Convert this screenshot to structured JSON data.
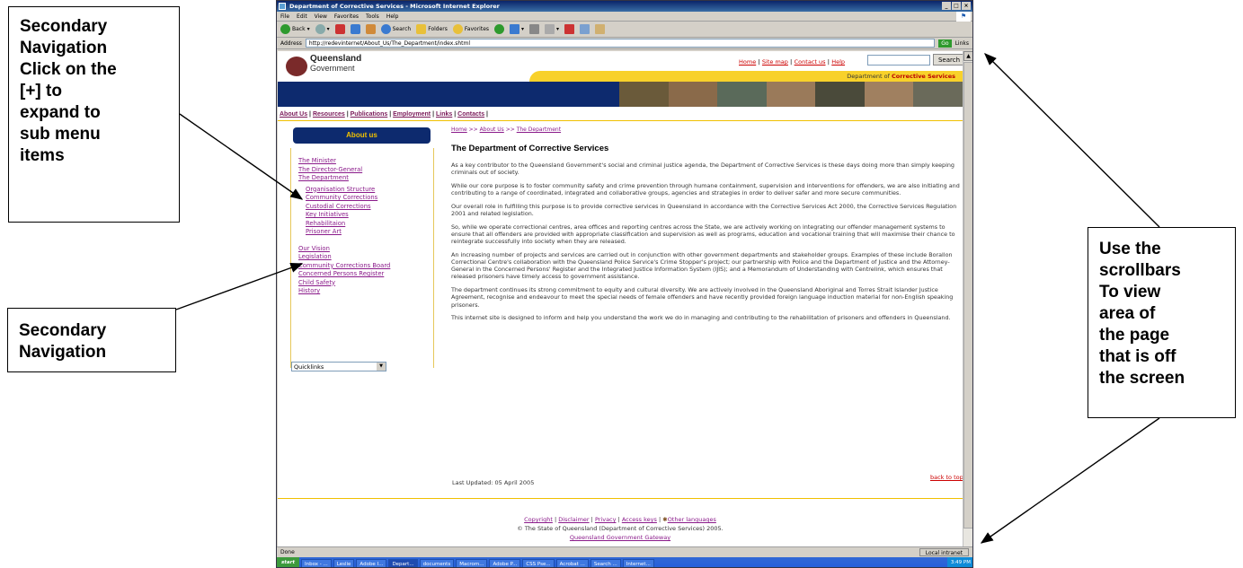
{
  "callouts": {
    "secondary_nav_expand": [
      "Secondary",
      "Navigation",
      "Click on the",
      "[+] to",
      "expand to",
      "sub menu",
      "items"
    ],
    "secondary_nav": [
      "Secondary",
      "Navigation"
    ],
    "scrollbars": [
      "Use the",
      "scrollbars",
      "To view",
      "area of",
      "the page",
      "that is off",
      "the screen"
    ]
  },
  "browser": {
    "title": "Department of Corrective Services - Microsoft Internet Explorer",
    "menu": [
      "File",
      "Edit",
      "View",
      "Favorites",
      "Tools",
      "Help"
    ],
    "toolbar": {
      "back": "Back",
      "search": "Search",
      "folders": "Folders",
      "favorites": "Favorites"
    },
    "address_label": "Address",
    "address": "http://redevinternet/About_Us/The_Department/index.shtml",
    "go": "Go",
    "links": "Links",
    "status": "Done",
    "zone": "Local intranet"
  },
  "taskbar": {
    "start": "start",
    "tasks": [
      "Inbox - ...",
      "Leslie",
      "Adobe I...",
      "Depart...",
      "documents",
      "Macrom...",
      "Adobe P...",
      "CSS Pse...",
      "Acrobat ...",
      "Search ...",
      "Internet..."
    ],
    "active_index": 3,
    "clock": "3:49 PM"
  },
  "site": {
    "logo_line1": "Queensland",
    "logo_line2": "Government",
    "top_links": [
      "Home",
      "Site map",
      "Contact us",
      "Help"
    ],
    "search_button": "Search",
    "dept_prefix": "Department of ",
    "dept_bold": "Corrective Services",
    "main_nav": [
      "About Us",
      "Resources",
      "Publications",
      "Employment",
      "Links",
      "Contacts"
    ],
    "left_heading": "About us",
    "left_nav": {
      "group1": [
        "The Minister",
        "The Director-General",
        "The Department"
      ],
      "sub": [
        "Organisation Structure",
        "Community Corrections",
        "Custodial Corrections",
        "Key Initiatives",
        "Rehabilitaion",
        "Prisoner Art"
      ],
      "group2": [
        "Our Vision",
        "Legislation",
        "Community Corrections Board",
        "Concerned Persons Register",
        "Child Safety",
        "History"
      ]
    },
    "quicklinks": "Quicklinks",
    "breadcrumb": [
      "Home",
      "About Us",
      "The Department"
    ],
    "breadcrumb_sep": ">>",
    "page_title": "The Department of Corrective Services",
    "paragraphs": [
      "As a key contributor to the Queensland Government's social and criminal justice agenda, the Department of Corrective Services is these days doing more than simply keeping criminals out of society.",
      "While our core purpose is to foster community safety and crime prevention through humane containment, supervision and interventions for offenders, we are also initiating and contributing to a range of coordinated, integrated and collaborative groups, agencies and strategies in order to deliver safer and more secure communities.",
      "Our overall role in fulfilling this purpose is to provide corrective services in Queensland in accordance with the Corrective Services Act 2000, the Corrective Services Regulation 2001 and related legislation.",
      "So, while we operate correctional centres, area offices and reporting centres across the State, we are actively working on integrating our offender management systems to ensure that all offenders are provided with appropriate classification and supervision as well as programs, education and vocational training that will maximise their chance to reintegrate successfully into society when they are released.",
      "An increasing number of projects and services are carried out in conjunction with other government departments and stakeholder groups. Examples of these include Borallon Correctional Centre's collaboration with the Queensland Police Service's Crime Stopper's project; our partnership with Police and the Department of Justice and the Attorney-General in the Concerned Persons' Register and the Integrated Justice Information System (IJIS); and a Memorandum of Understanding with Centrelink, which ensures that released prisoners have timely access to government assistance.",
      "The department continues its strong commitment to equity and cultural diversity. We are actively involved in the Queensland Aboriginal and Torres Strait Islander Justice Agreement, recognise and endeavour to meet the special needs of female offenders and have recently provided foreign language induction material for non-English speaking prisoners.",
      "This internet site is designed to inform and help you understand the work we do in managing and contributing to the rehabilitation of prisoners and offenders in Queensland."
    ],
    "back_to_top": "back to top ^",
    "last_updated": "Last Updated: 05 April 2005",
    "footer_links": [
      "Copyright",
      "Disclaimer",
      "Privacy",
      "Access keys",
      "Other languages"
    ],
    "footer_copyright": "© The State of Queensland (Department of Corrective Services) 2005.",
    "footer_gateway": "Queensland Government Gateway"
  },
  "colors": {
    "navy": "#0d2a6e",
    "gold": "#f8d12a",
    "link": "#8a1a8a",
    "red_link": "#cc0000"
  }
}
